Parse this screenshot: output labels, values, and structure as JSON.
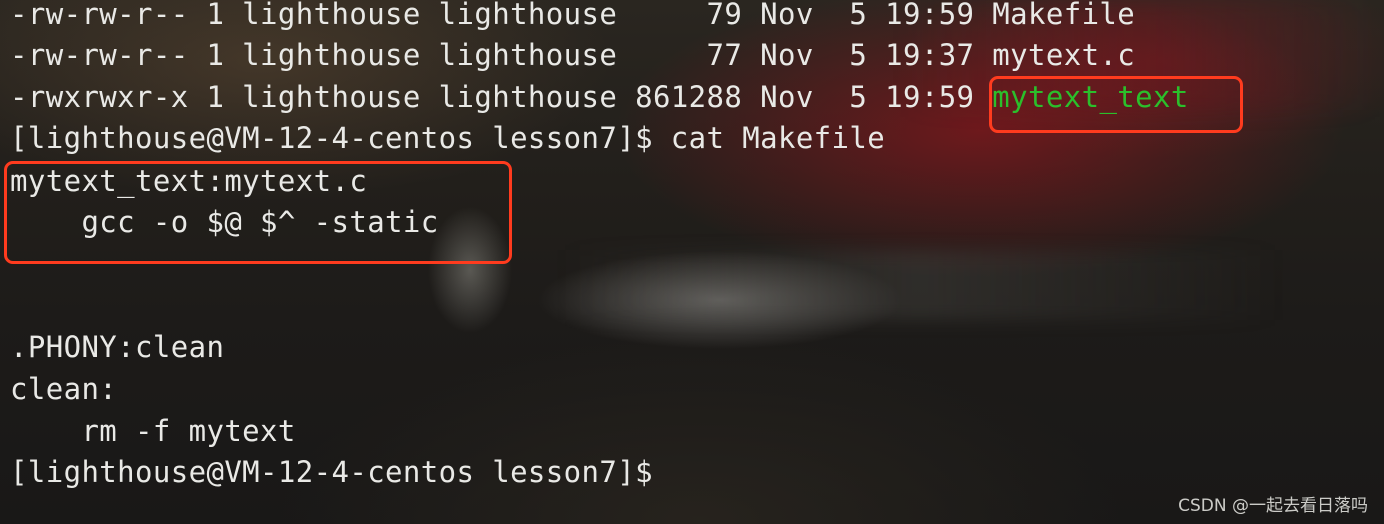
{
  "terminal": {
    "lines": [
      "-rw-rw-r-- 1 lighthouse lighthouse     79 Nov  5 19:59 Makefile",
      "-rw-rw-r-- 1 lighthouse lighthouse     77 Nov  5 19:37 mytext.c",
      "-rwxrwxr-x 1 lighthouse lighthouse 861288 Nov  5 19:59 ",
      "[lighthouse@VM-12-4-centos lesson7]$ cat Makefile",
      "mytext_text:mytext.c",
      "    gcc -o $@ $^ -static",
      "",
      "",
      ".PHONY:clean",
      "clean:",
      "    rm -f mytext",
      "[lighthouse@VM-12-4-centos lesson7]$"
    ],
    "executable_name": "mytext_text"
  },
  "colors": {
    "executable": "#2bbf2b",
    "highlight_box": "#ff3b1e",
    "text": "#e9e9e6"
  },
  "watermark": "CSDN @一起去看日落吗"
}
